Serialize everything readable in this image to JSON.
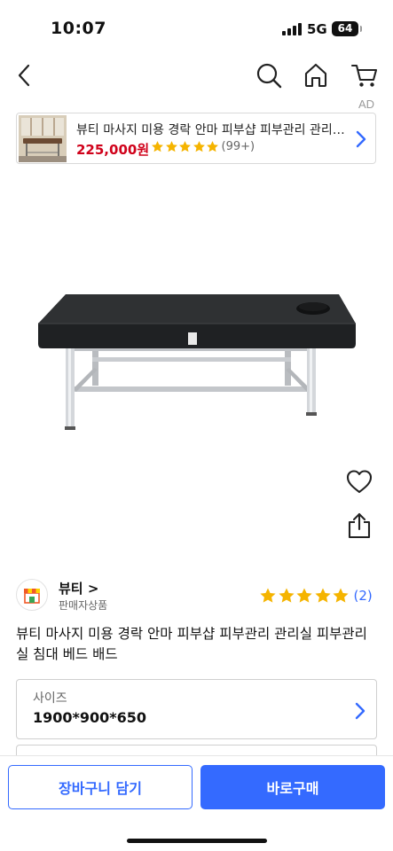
{
  "status_bar": {
    "time": "10:07",
    "network": "5G",
    "battery": "64"
  },
  "ad": {
    "label": "AD",
    "title": "뷰티 마사지 미용 경락 안마 피부샵 피부관리 관리실 피부관리실 침대 베드 배드",
    "price": "225,000원",
    "rating_count": "(99+)",
    "star_count": 5
  },
  "seller": {
    "name": "뷰티 >",
    "type": "판매자상품",
    "rating_count": "(2)",
    "star_count": 5
  },
  "product": {
    "title": "뷰티 마사지 미용 경락 안마 피부샵 피부관리 관리실 피부관리실 침대 베드 배드"
  },
  "option": {
    "label": "사이즈",
    "value": "1900*900*650"
  },
  "actions": {
    "cart_label": "장바구니 담기",
    "buy_label": "바로구매"
  },
  "icons": {
    "back": "chevron-left-icon",
    "search": "search-icon",
    "home": "home-icon",
    "cart": "cart-icon",
    "wishlist": "heart-icon",
    "share": "share-icon",
    "chevron": "chevron-right-icon",
    "star": "star-icon"
  },
  "colors": {
    "accent": "#346aff",
    "price": "#d0021b",
    "star": "#f5b400"
  }
}
